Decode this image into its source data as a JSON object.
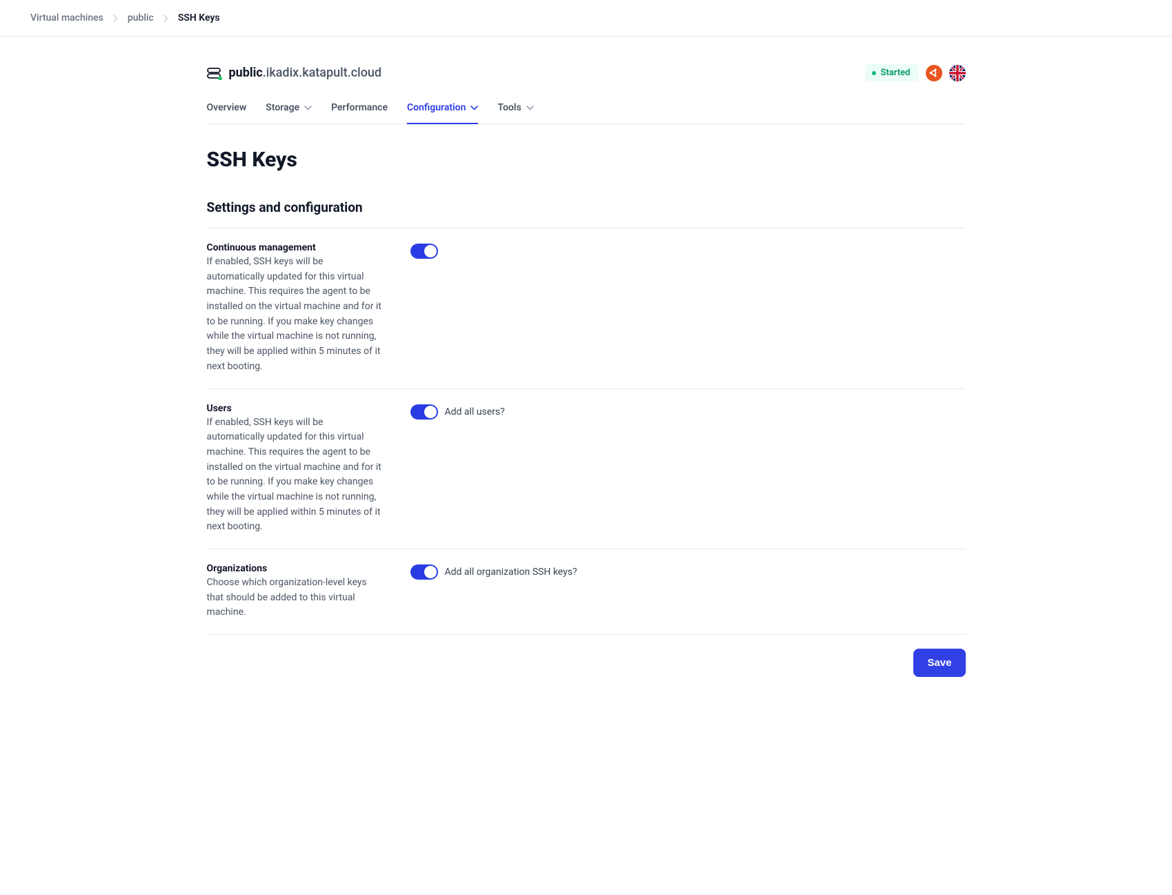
{
  "breadcrumb": {
    "items": [
      "Virtual machines",
      "public",
      "SSH Keys"
    ]
  },
  "vm": {
    "hostname_bold": "public",
    "hostname_rest": ".ikadix.katapult.cloud",
    "status_label": "Started"
  },
  "tabs": {
    "overview": "Overview",
    "storage": "Storage",
    "performance": "Performance",
    "configuration": "Configuration",
    "tools": "Tools"
  },
  "page": {
    "title": "SSH Keys",
    "section_title": "Settings and configuration"
  },
  "settings": {
    "continuous": {
      "label": "Continuous management",
      "desc": "If enabled, SSH keys will be automatically updated for this virtual machine. This requires the agent to be installed on the virtual machine and for it to be running. If you make key changes while the virtual machine is not running, they will be applied within 5 minutes of it next booting.",
      "enabled": true
    },
    "users": {
      "label": "Users",
      "desc": "If enabled, SSH keys will be automatically updated for this virtual machine. This requires the agent to be installed on the virtual machine and for it to be running. If you make key changes while the virtual machine is not running, they will be applied within 5 minutes of it next booting.",
      "toggle_label": "Add all users?",
      "enabled": true
    },
    "organizations": {
      "label": "Organizations",
      "desc": "Choose which organization-level keys that should be added to this virtual machine.",
      "toggle_label": "Add all organization SSH keys?",
      "enabled": true
    }
  },
  "actions": {
    "save": "Save"
  },
  "colors": {
    "primary": "#2a3ce3",
    "success_bg": "#ecfdf5",
    "success_text": "#059669",
    "ubuntu": "#e95420"
  }
}
